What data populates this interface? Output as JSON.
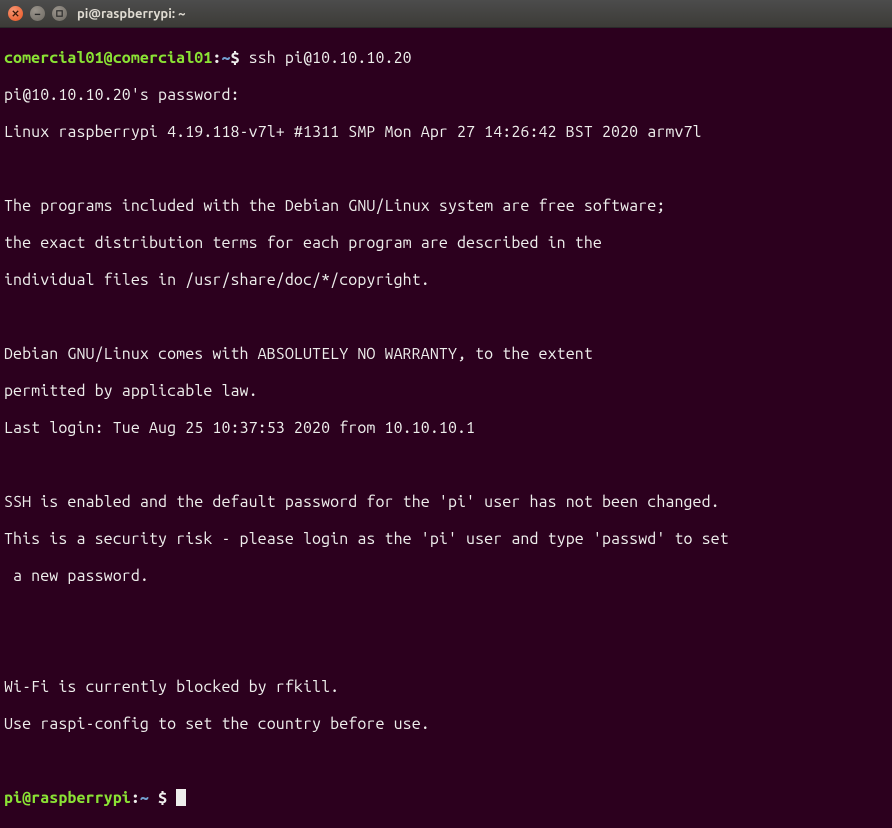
{
  "titlebar": {
    "title": "pi@raspberrypi: ~"
  },
  "prompt1": {
    "user": "comercial01@comercial01",
    "path": "~",
    "command": "ssh pi@10.10.10.20"
  },
  "lines": {
    "l1": "pi@10.10.10.20's password: ",
    "l2": "Linux raspberrypi 4.19.118-v7l+ #1311 SMP Mon Apr 27 14:26:42 BST 2020 armv7l",
    "l3": "",
    "l4": "The programs included with the Debian GNU/Linux system are free software;",
    "l5": "the exact distribution terms for each program are described in the",
    "l6": "individual files in /usr/share/doc/*/copyright.",
    "l7": "",
    "l8": "Debian GNU/Linux comes with ABSOLUTELY NO WARRANTY, to the extent",
    "l9": "permitted by applicable law.",
    "l10": "Last login: Tue Aug 25 10:37:53 2020 from 10.10.10.1",
    "l11": "",
    "l12": "SSH is enabled and the default password for the 'pi' user has not been changed.",
    "l13": "This is a security risk - please login as the 'pi' user and type 'passwd' to set",
    "l14": " a new password.",
    "l15": "",
    "l16": "",
    "l17": "Wi-Fi is currently blocked by rfkill.",
    "l18": "Use raspi-config to set the country before use."
  },
  "prompt2": {
    "user": "pi@raspberrypi",
    "path": "~",
    "dollar": "$"
  }
}
